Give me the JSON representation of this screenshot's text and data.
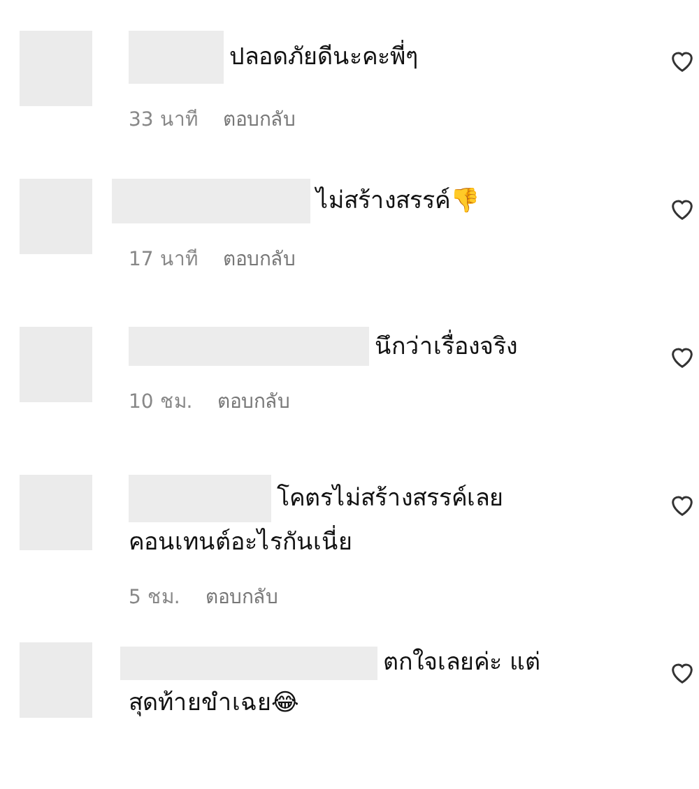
{
  "comments": [
    {
      "lines": [
        "ปลอดภัยดีนะคะพี่ๆ"
      ],
      "time": "33 นาที",
      "reply": "ตอบกลับ",
      "liked": false
    },
    {
      "lines": [
        "ไม่สร้างสรรค์👎"
      ],
      "time": "17 นาที",
      "reply": "ตอบกลับ",
      "liked": false
    },
    {
      "lines": [
        "นึกว่าเรื่องจริง"
      ],
      "time": "10 ชม.",
      "reply": "ตอบกลับ",
      "liked": false
    },
    {
      "lines": [
        "โคตรไม่สร้างสรรค์เลย",
        "คอนเทนต์อะไรกันเนี่ย"
      ],
      "time": "5 ชม.",
      "reply": "ตอบกลับ",
      "liked": false
    },
    {
      "lines": [
        "ตกใจเลยค่ะ แต่",
        "สุดท้ายขำเฉย😂"
      ],
      "liked": false
    }
  ]
}
